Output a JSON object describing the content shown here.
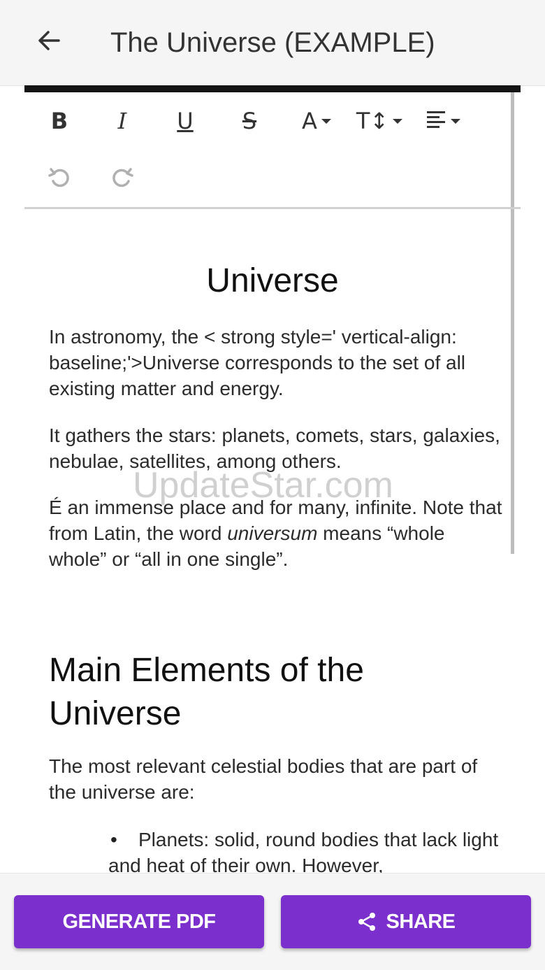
{
  "appbar": {
    "title": "The Universe (EXAMPLE)",
    "back_icon": "arrow-left-icon"
  },
  "toolbar": {
    "bold": "B",
    "italic": "I",
    "underline": "U",
    "strikethrough": "S",
    "text_color": "A",
    "font_size": "T↕",
    "icons": [
      "bold-icon",
      "italic-icon",
      "underline-icon",
      "strikethrough-icon",
      "text-color-icon",
      "font-size-icon",
      "align-icon",
      "undo-icon",
      "redo-icon"
    ]
  },
  "document": {
    "title": "Universe",
    "paragraphs": [
      "In astronomy, the < strong style=' vertical-align: baseline;'>Universe corresponds to the set of all existing matter and energy.",
      "It gathers the stars: planets, comets, stars, galaxies, nebulae, satellites, among others."
    ],
    "para3_before": "É an immense place and for many, infinite. Note that from Latin, the word ",
    "para3_italic": "universum",
    "para3_after": " means “whole whole” or “all in one single”.",
    "heading2": "Main Elements of the Universe",
    "para4": "The most relevant celestial bodies that are part of the universe are:",
    "bullet_1": "Planets: solid, round bodies that lack light and heat of their own. However,"
  },
  "watermark": "UpdateStar.com",
  "actions": {
    "generate_pdf": "GENERATE PDF",
    "share": "SHARE",
    "share_icon": "share-icon"
  },
  "colors": {
    "accent": "#7b2fcc",
    "appbar_bg": "#f5f5f5"
  }
}
